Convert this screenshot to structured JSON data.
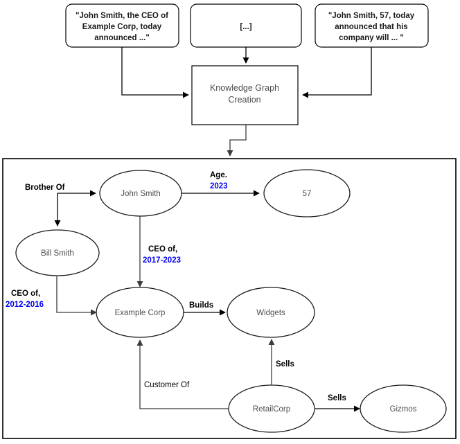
{
  "sources": [
    {
      "id": "source-1",
      "text_lines": [
        "\"John Smith, the CEO of",
        "Example Corp, today",
        "announced ...\""
      ]
    },
    {
      "id": "source-2",
      "text_lines": [
        "[...]"
      ]
    },
    {
      "id": "source-3",
      "text_lines": [
        "\"John Smith, 57, today",
        "announced that his",
        "company will ... \""
      ]
    }
  ],
  "process": {
    "label_lines": [
      "Knowledge Graph",
      "Creation"
    ]
  },
  "graph": {
    "nodes": [
      {
        "id": "john-smith",
        "label": "John Smith"
      },
      {
        "id": "bill-smith",
        "label": "Bill Smith"
      },
      {
        "id": "age-57",
        "label": "57"
      },
      {
        "id": "example-corp",
        "label": "Example Corp"
      },
      {
        "id": "widgets",
        "label": "Widgets"
      },
      {
        "id": "retailcorp",
        "label": "RetailCorp"
      },
      {
        "id": "gizmos",
        "label": "Gizmos"
      }
    ],
    "edges": [
      {
        "id": "brother-of",
        "from": "john-smith",
        "to": "bill-smith",
        "label": "Brother Of",
        "qualifier": "",
        "bold": true
      },
      {
        "id": "age-2023",
        "from": "john-smith",
        "to": "age-57",
        "label": "Age.",
        "qualifier": "2023",
        "bold": true
      },
      {
        "id": "ceo-of-2017",
        "from": "john-smith",
        "to": "example-corp",
        "label": "CEO of,",
        "qualifier": "2017-2023",
        "bold": true
      },
      {
        "id": "ceo-of-2012",
        "from": "bill-smith",
        "to": "example-corp",
        "label": "CEO of,",
        "qualifier": "2012-2016",
        "bold": true
      },
      {
        "id": "builds",
        "from": "example-corp",
        "to": "widgets",
        "label": "Builds",
        "qualifier": "",
        "bold": true
      },
      {
        "id": "sells-widgets",
        "from": "retailcorp",
        "to": "widgets",
        "label": "Sells",
        "qualifier": "",
        "bold": true
      },
      {
        "id": "sells-gizmos",
        "from": "retailcorp",
        "to": "gizmos",
        "label": "Sells",
        "qualifier": "",
        "bold": true
      },
      {
        "id": "customer-of",
        "from": "retailcorp",
        "to": "example-corp",
        "label": "Customer Of",
        "qualifier": "",
        "bold": false
      }
    ]
  },
  "colors": {
    "qualifier_blue": "#0000ee",
    "node_text": "#4d4d4d",
    "stroke": "#000000"
  }
}
